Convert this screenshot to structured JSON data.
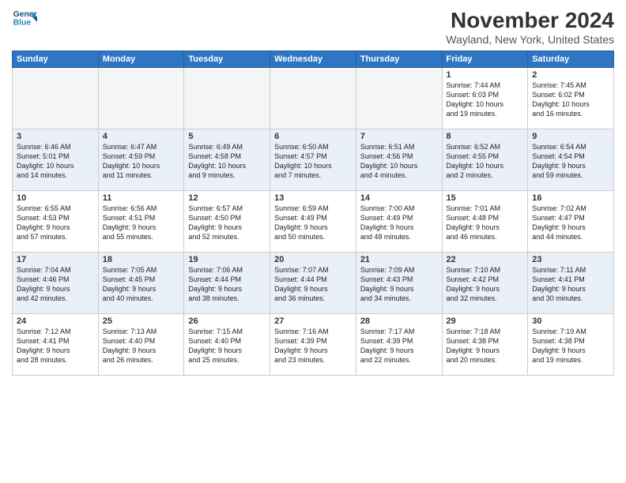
{
  "header": {
    "logo_line1": "General",
    "logo_line2": "Blue",
    "title": "November 2024",
    "location": "Wayland, New York, United States"
  },
  "weekdays": [
    "Sunday",
    "Monday",
    "Tuesday",
    "Wednesday",
    "Thursday",
    "Friday",
    "Saturday"
  ],
  "weeks": [
    [
      {
        "day": "",
        "info": ""
      },
      {
        "day": "",
        "info": ""
      },
      {
        "day": "",
        "info": ""
      },
      {
        "day": "",
        "info": ""
      },
      {
        "day": "",
        "info": ""
      },
      {
        "day": "1",
        "info": "Sunrise: 7:44 AM\nSunset: 6:03 PM\nDaylight: 10 hours\nand 19 minutes."
      },
      {
        "day": "2",
        "info": "Sunrise: 7:45 AM\nSunset: 6:02 PM\nDaylight: 10 hours\nand 16 minutes."
      }
    ],
    [
      {
        "day": "3",
        "info": "Sunrise: 6:46 AM\nSunset: 5:01 PM\nDaylight: 10 hours\nand 14 minutes."
      },
      {
        "day": "4",
        "info": "Sunrise: 6:47 AM\nSunset: 4:59 PM\nDaylight: 10 hours\nand 11 minutes."
      },
      {
        "day": "5",
        "info": "Sunrise: 6:49 AM\nSunset: 4:58 PM\nDaylight: 10 hours\nand 9 minutes."
      },
      {
        "day": "6",
        "info": "Sunrise: 6:50 AM\nSunset: 4:57 PM\nDaylight: 10 hours\nand 7 minutes."
      },
      {
        "day": "7",
        "info": "Sunrise: 6:51 AM\nSunset: 4:56 PM\nDaylight: 10 hours\nand 4 minutes."
      },
      {
        "day": "8",
        "info": "Sunrise: 6:52 AM\nSunset: 4:55 PM\nDaylight: 10 hours\nand 2 minutes."
      },
      {
        "day": "9",
        "info": "Sunrise: 6:54 AM\nSunset: 4:54 PM\nDaylight: 9 hours\nand 59 minutes."
      }
    ],
    [
      {
        "day": "10",
        "info": "Sunrise: 6:55 AM\nSunset: 4:53 PM\nDaylight: 9 hours\nand 57 minutes."
      },
      {
        "day": "11",
        "info": "Sunrise: 6:56 AM\nSunset: 4:51 PM\nDaylight: 9 hours\nand 55 minutes."
      },
      {
        "day": "12",
        "info": "Sunrise: 6:57 AM\nSunset: 4:50 PM\nDaylight: 9 hours\nand 52 minutes."
      },
      {
        "day": "13",
        "info": "Sunrise: 6:59 AM\nSunset: 4:49 PM\nDaylight: 9 hours\nand 50 minutes."
      },
      {
        "day": "14",
        "info": "Sunrise: 7:00 AM\nSunset: 4:49 PM\nDaylight: 9 hours\nand 48 minutes."
      },
      {
        "day": "15",
        "info": "Sunrise: 7:01 AM\nSunset: 4:48 PM\nDaylight: 9 hours\nand 46 minutes."
      },
      {
        "day": "16",
        "info": "Sunrise: 7:02 AM\nSunset: 4:47 PM\nDaylight: 9 hours\nand 44 minutes."
      }
    ],
    [
      {
        "day": "17",
        "info": "Sunrise: 7:04 AM\nSunset: 4:46 PM\nDaylight: 9 hours\nand 42 minutes."
      },
      {
        "day": "18",
        "info": "Sunrise: 7:05 AM\nSunset: 4:45 PM\nDaylight: 9 hours\nand 40 minutes."
      },
      {
        "day": "19",
        "info": "Sunrise: 7:06 AM\nSunset: 4:44 PM\nDaylight: 9 hours\nand 38 minutes."
      },
      {
        "day": "20",
        "info": "Sunrise: 7:07 AM\nSunset: 4:44 PM\nDaylight: 9 hours\nand 36 minutes."
      },
      {
        "day": "21",
        "info": "Sunrise: 7:09 AM\nSunset: 4:43 PM\nDaylight: 9 hours\nand 34 minutes."
      },
      {
        "day": "22",
        "info": "Sunrise: 7:10 AM\nSunset: 4:42 PM\nDaylight: 9 hours\nand 32 minutes."
      },
      {
        "day": "23",
        "info": "Sunrise: 7:11 AM\nSunset: 4:41 PM\nDaylight: 9 hours\nand 30 minutes."
      }
    ],
    [
      {
        "day": "24",
        "info": "Sunrise: 7:12 AM\nSunset: 4:41 PM\nDaylight: 9 hours\nand 28 minutes."
      },
      {
        "day": "25",
        "info": "Sunrise: 7:13 AM\nSunset: 4:40 PM\nDaylight: 9 hours\nand 26 minutes."
      },
      {
        "day": "26",
        "info": "Sunrise: 7:15 AM\nSunset: 4:40 PM\nDaylight: 9 hours\nand 25 minutes."
      },
      {
        "day": "27",
        "info": "Sunrise: 7:16 AM\nSunset: 4:39 PM\nDaylight: 9 hours\nand 23 minutes."
      },
      {
        "day": "28",
        "info": "Sunrise: 7:17 AM\nSunset: 4:39 PM\nDaylight: 9 hours\nand 22 minutes."
      },
      {
        "day": "29",
        "info": "Sunrise: 7:18 AM\nSunset: 4:38 PM\nDaylight: 9 hours\nand 20 minutes."
      },
      {
        "day": "30",
        "info": "Sunrise: 7:19 AM\nSunset: 4:38 PM\nDaylight: 9 hours\nand 19 minutes."
      }
    ]
  ]
}
